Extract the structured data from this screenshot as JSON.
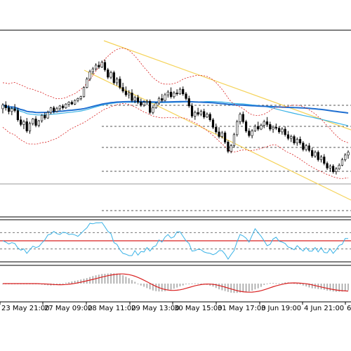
{
  "chart_data": {
    "type": "candlestick",
    "panels": [
      "price",
      "oscillator",
      "histogram"
    ],
    "x_tick_labels": [
      "23 May 21:00",
      "27 May 09:00",
      "28 May 11:00",
      "29 May 13:00",
      "30 May 15:00",
      "31 May 17:00",
      "3 Jun 19:00",
      "4 Jun 21:00",
      "6"
    ],
    "bars_count": 124,
    "price": {
      "ylim": [
        0,
        100
      ],
      "grid": "horizontal dashed levels",
      "candles": [
        {
          "o": 58.0,
          "h": 61.0,
          "l": 55.5,
          "c": 60.0
        },
        {
          "o": 60.0,
          "h": 62.0,
          "l": 57.0,
          "c": 58.5
        },
        {
          "o": 58.5,
          "h": 60.0,
          "l": 55.0,
          "c": 56.5
        },
        {
          "o": 56.5,
          "h": 59.0,
          "l": 54.5,
          "c": 58.0
        },
        {
          "o": 58.0,
          "h": 60.5,
          "l": 56.0,
          "c": 57.0
        },
        {
          "o": 57.0,
          "h": 58.5,
          "l": 51.0,
          "c": 52.0
        },
        {
          "o": 52.0,
          "h": 54.0,
          "l": 48.5,
          "c": 49.5
        },
        {
          "o": 49.5,
          "h": 52.0,
          "l": 47.0,
          "c": 51.0
        },
        {
          "o": 51.0,
          "h": 53.0,
          "l": 45.0,
          "c": 46.0
        },
        {
          "o": 46.0,
          "h": 51.0,
          "l": 44.5,
          "c": 50.0
        },
        {
          "o": 50.0,
          "h": 53.0,
          "l": 49.0,
          "c": 52.5
        },
        {
          "o": 52.5,
          "h": 54.0,
          "l": 48.0,
          "c": 49.0
        },
        {
          "o": 49.0,
          "h": 52.0,
          "l": 48.0,
          "c": 51.5
        },
        {
          "o": 51.5,
          "h": 55.0,
          "l": 50.5,
          "c": 54.5
        },
        {
          "o": 54.5,
          "h": 56.0,
          "l": 52.0,
          "c": 53.0
        },
        {
          "o": 53.0,
          "h": 57.0,
          "l": 52.5,
          "c": 56.0
        },
        {
          "o": 56.0,
          "h": 59.0,
          "l": 55.0,
          "c": 58.5
        },
        {
          "o": 58.5,
          "h": 59.5,
          "l": 55.5,
          "c": 56.5
        },
        {
          "o": 56.5,
          "h": 59.0,
          "l": 56.0,
          "c": 58.0
        },
        {
          "o": 58.0,
          "h": 60.0,
          "l": 57.0,
          "c": 59.5
        },
        {
          "o": 59.5,
          "h": 60.5,
          "l": 57.5,
          "c": 58.5
        },
        {
          "o": 58.5,
          "h": 61.0,
          "l": 58.0,
          "c": 60.5
        },
        {
          "o": 60.5,
          "h": 62.0,
          "l": 59.0,
          "c": 61.5
        },
        {
          "o": 61.5,
          "h": 62.5,
          "l": 60.0,
          "c": 60.5
        },
        {
          "o": 60.5,
          "h": 63.0,
          "l": 60.0,
          "c": 62.5
        },
        {
          "o": 62.5,
          "h": 64.0,
          "l": 61.5,
          "c": 63.5
        },
        {
          "o": 63.5,
          "h": 65.0,
          "l": 62.5,
          "c": 64.5
        },
        {
          "o": 64.5,
          "h": 70.0,
          "l": 64.0,
          "c": 69.5
        },
        {
          "o": 69.5,
          "h": 75.0,
          "l": 69.0,
          "c": 74.0
        },
        {
          "o": 74.0,
          "h": 79.0,
          "l": 73.0,
          "c": 78.0
        },
        {
          "o": 78.0,
          "h": 80.5,
          "l": 76.5,
          "c": 79.5
        },
        {
          "o": 79.5,
          "h": 82.5,
          "l": 78.5,
          "c": 81.5
        },
        {
          "o": 81.5,
          "h": 83.5,
          "l": 79.5,
          "c": 80.5
        },
        {
          "o": 80.5,
          "h": 84.0,
          "l": 80.0,
          "c": 83.0
        },
        {
          "o": 83.0,
          "h": 84.5,
          "l": 78.0,
          "c": 79.0
        },
        {
          "o": 79.0,
          "h": 80.0,
          "l": 74.0,
          "c": 75.0
        },
        {
          "o": 75.0,
          "h": 78.5,
          "l": 74.0,
          "c": 77.5
        },
        {
          "o": 77.5,
          "h": 78.5,
          "l": 71.0,
          "c": 72.0
        },
        {
          "o": 72.0,
          "h": 75.0,
          "l": 70.5,
          "c": 74.0
        },
        {
          "o": 74.0,
          "h": 75.5,
          "l": 68.5,
          "c": 69.5
        },
        {
          "o": 69.5,
          "h": 72.0,
          "l": 66.5,
          "c": 67.5
        },
        {
          "o": 67.5,
          "h": 70.0,
          "l": 64.5,
          "c": 65.5
        },
        {
          "o": 65.5,
          "h": 68.0,
          "l": 63.5,
          "c": 66.5
        },
        {
          "o": 66.5,
          "h": 68.5,
          "l": 61.5,
          "c": 62.5
        },
        {
          "o": 62.5,
          "h": 65.0,
          "l": 61.0,
          "c": 64.0
        },
        {
          "o": 64.0,
          "h": 65.5,
          "l": 60.5,
          "c": 61.5
        },
        {
          "o": 61.5,
          "h": 63.5,
          "l": 59.0,
          "c": 60.0
        },
        {
          "o": 60.0,
          "h": 62.5,
          "l": 59.0,
          "c": 61.5
        },
        {
          "o": 61.5,
          "h": 63.0,
          "l": 60.0,
          "c": 62.0
        },
        {
          "o": 62.0,
          "h": 63.0,
          "l": 55.0,
          "c": 56.0
        },
        {
          "o": 56.0,
          "h": 59.5,
          "l": 55.0,
          "c": 58.5
        },
        {
          "o": 58.5,
          "h": 61.5,
          "l": 58.0,
          "c": 61.0
        },
        {
          "o": 61.0,
          "h": 64.5,
          "l": 60.0,
          "c": 63.5
        },
        {
          "o": 63.5,
          "h": 66.0,
          "l": 61.5,
          "c": 62.5
        },
        {
          "o": 62.5,
          "h": 66.5,
          "l": 62.0,
          "c": 65.5
        },
        {
          "o": 65.5,
          "h": 68.0,
          "l": 64.0,
          "c": 67.0
        },
        {
          "o": 67.0,
          "h": 69.5,
          "l": 63.5,
          "c": 64.5
        },
        {
          "o": 64.5,
          "h": 67.5,
          "l": 63.5,
          "c": 66.5
        },
        {
          "o": 66.5,
          "h": 68.5,
          "l": 65.0,
          "c": 66.0
        },
        {
          "o": 66.0,
          "h": 69.5,
          "l": 65.5,
          "c": 68.5
        },
        {
          "o": 68.5,
          "h": 70.0,
          "l": 65.0,
          "c": 66.0
        },
        {
          "o": 66.0,
          "h": 67.0,
          "l": 62.5,
          "c": 63.5
        },
        {
          "o": 63.5,
          "h": 65.0,
          "l": 58.5,
          "c": 59.5
        },
        {
          "o": 59.5,
          "h": 61.0,
          "l": 53.0,
          "c": 54.0
        },
        {
          "o": 54.0,
          "h": 57.0,
          "l": 52.0,
          "c": 56.0
        },
        {
          "o": 56.0,
          "h": 58.5,
          "l": 54.0,
          "c": 55.0
        },
        {
          "o": 55.0,
          "h": 57.5,
          "l": 54.0,
          "c": 56.5
        },
        {
          "o": 56.5,
          "h": 58.0,
          "l": 52.5,
          "c": 53.5
        },
        {
          "o": 53.5,
          "h": 56.0,
          "l": 53.0,
          "c": 55.0
        },
        {
          "o": 55.0,
          "h": 56.0,
          "l": 51.0,
          "c": 52.0
        },
        {
          "o": 52.0,
          "h": 53.0,
          "l": 47.0,
          "c": 48.0
        },
        {
          "o": 48.0,
          "h": 50.0,
          "l": 44.5,
          "c": 45.5
        },
        {
          "o": 45.5,
          "h": 48.0,
          "l": 42.0,
          "c": 43.0
        },
        {
          "o": 43.0,
          "h": 46.0,
          "l": 42.0,
          "c": 45.0
        },
        {
          "o": 45.0,
          "h": 46.0,
          "l": 39.0,
          "c": 40.0
        },
        {
          "o": 40.0,
          "h": 41.0,
          "l": 34.0,
          "c": 35.0
        },
        {
          "o": 35.0,
          "h": 39.0,
          "l": 34.0,
          "c": 38.0
        },
        {
          "o": 38.0,
          "h": 45.0,
          "l": 37.0,
          "c": 44.0
        },
        {
          "o": 44.0,
          "h": 52.0,
          "l": 43.0,
          "c": 51.0
        },
        {
          "o": 51.0,
          "h": 56.0,
          "l": 49.5,
          "c": 55.0
        },
        {
          "o": 55.0,
          "h": 56.5,
          "l": 50.0,
          "c": 51.0
        },
        {
          "o": 51.0,
          "h": 52.0,
          "l": 45.0,
          "c": 46.0
        },
        {
          "o": 46.0,
          "h": 47.5,
          "l": 42.5,
          "c": 43.5
        },
        {
          "o": 43.5,
          "h": 47.0,
          "l": 42.0,
          "c": 46.0
        },
        {
          "o": 46.0,
          "h": 49.5,
          "l": 45.5,
          "c": 48.5
        },
        {
          "o": 48.5,
          "h": 51.0,
          "l": 46.0,
          "c": 47.0
        },
        {
          "o": 47.0,
          "h": 50.0,
          "l": 46.5,
          "c": 49.0
        },
        {
          "o": 49.0,
          "h": 52.0,
          "l": 47.5,
          "c": 51.0
        },
        {
          "o": 51.0,
          "h": 53.5,
          "l": 48.5,
          "c": 49.5
        },
        {
          "o": 49.5,
          "h": 51.0,
          "l": 46.0,
          "c": 47.0
        },
        {
          "o": 47.0,
          "h": 49.0,
          "l": 45.0,
          "c": 48.0
        },
        {
          "o": 48.0,
          "h": 50.0,
          "l": 46.5,
          "c": 47.5
        },
        {
          "o": 47.5,
          "h": 48.5,
          "l": 44.5,
          "c": 45.5
        },
        {
          "o": 45.5,
          "h": 48.0,
          "l": 44.0,
          "c": 47.0
        },
        {
          "o": 47.0,
          "h": 48.5,
          "l": 43.0,
          "c": 44.0
        },
        {
          "o": 44.0,
          "h": 46.0,
          "l": 41.0,
          "c": 42.0
        },
        {
          "o": 42.0,
          "h": 44.0,
          "l": 40.0,
          "c": 43.0
        },
        {
          "o": 43.0,
          "h": 44.0,
          "l": 38.5,
          "c": 39.5
        },
        {
          "o": 39.5,
          "h": 42.5,
          "l": 38.0,
          "c": 41.5
        },
        {
          "o": 41.5,
          "h": 43.0,
          "l": 38.5,
          "c": 39.5
        },
        {
          "o": 39.5,
          "h": 40.5,
          "l": 35.0,
          "c": 36.0
        },
        {
          "o": 36.0,
          "h": 39.0,
          "l": 35.0,
          "c": 38.0
        },
        {
          "o": 38.0,
          "h": 39.5,
          "l": 34.5,
          "c": 35.5
        },
        {
          "o": 35.5,
          "h": 37.0,
          "l": 31.5,
          "c": 32.5
        },
        {
          "o": 32.5,
          "h": 35.5,
          "l": 31.5,
          "c": 34.5
        },
        {
          "o": 34.5,
          "h": 35.5,
          "l": 29.5,
          "c": 30.5
        },
        {
          "o": 30.5,
          "h": 33.0,
          "l": 29.0,
          "c": 32.0
        },
        {
          "o": 32.0,
          "h": 33.5,
          "l": 27.5,
          "c": 28.5
        },
        {
          "o": 28.5,
          "h": 29.5,
          "l": 25.0,
          "c": 26.0
        },
        {
          "o": 26.0,
          "h": 28.0,
          "l": 24.0,
          "c": 27.0
        },
        {
          "o": 27.0,
          "h": 28.0,
          "l": 23.0,
          "c": 24.0
        },
        {
          "o": 24.0,
          "h": 26.5,
          "l": 22.5,
          "c": 25.5
        },
        {
          "o": 25.5,
          "h": 28.5,
          "l": 25.0,
          "c": 27.5
        },
        {
          "o": 27.5,
          "h": 31.5,
          "l": 27.0,
          "c": 30.5
        },
        {
          "o": 30.5,
          "h": 34.0,
          "l": 29.5,
          "c": 33.0
        },
        {
          "o": 33.0,
          "h": 35.5,
          "l": 31.0,
          "c": 34.5
        }
      ]
    },
    "oscillator": {
      "ylim": [
        0,
        100
      ],
      "levels": [
        30,
        50,
        70
      ]
    },
    "histogram": {
      "ylim": [
        -50,
        50
      ]
    }
  }
}
